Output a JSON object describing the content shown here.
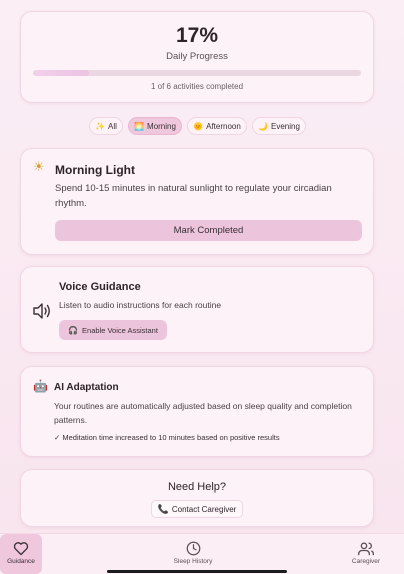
{
  "progress": {
    "percent": "17%",
    "label": "Daily Progress",
    "fraction": 0.17,
    "count_text": "1 of 6 activities completed"
  },
  "filters": [
    {
      "label": "All",
      "icon": "sparkle-icon",
      "active": false
    },
    {
      "label": "Morning",
      "icon": "sunrise-icon",
      "active": true
    },
    {
      "label": "Afternoon",
      "icon": "sun-icon",
      "active": false
    },
    {
      "label": "Evening",
      "icon": "moon-icon",
      "active": false
    }
  ],
  "morning_light": {
    "title": "Morning Light",
    "description": "Spend 10-15 minutes in natural sunlight to regulate your circadian rhythm.",
    "button": "Mark Completed"
  },
  "voice": {
    "title": "Voice Guidance",
    "description": "Listen to audio instructions for each routine",
    "button": "Enable Voice Assistant"
  },
  "ai": {
    "title": "AI Adaptation",
    "description": "Your routines are automatically adjusted based on sleep quality and completion patterns.",
    "note": "✓ Meditation time increased to 10 minutes based on positive results"
  },
  "help": {
    "title": "Need Help?",
    "button": "Contact Caregiver"
  },
  "nav": [
    {
      "label": "Guidance",
      "icon": "heart-icon",
      "active": true
    },
    {
      "label": "Sleep History",
      "icon": "clock-icon",
      "active": false
    },
    {
      "label": "Caregiver",
      "icon": "users-icon",
      "active": false
    }
  ],
  "colors": {
    "accent": "#ecc5dc",
    "background": "#fbeef5",
    "card": "#fdf2f7"
  }
}
